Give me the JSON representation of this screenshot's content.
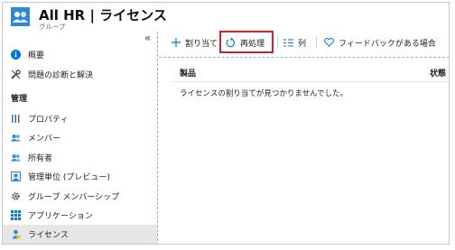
{
  "header": {
    "title": "All HR | ライセンス",
    "subtitle": "グループ"
  },
  "sidebar": {
    "collapse_glyph": "«",
    "items": [
      {
        "label": "概要",
        "icon": "info-icon"
      },
      {
        "label": "問題の診断と解決",
        "icon": "wrench-icon"
      }
    ],
    "section_label": "管理",
    "manage_items": [
      {
        "label": "プロパティ",
        "icon": "properties-icon"
      },
      {
        "label": "メンバー",
        "icon": "members-icon"
      },
      {
        "label": "所有者",
        "icon": "owners-icon"
      },
      {
        "label": "管理単位 (プレビュー)",
        "icon": "admin-unit-icon"
      },
      {
        "label": "グループ メンバーシップ",
        "icon": "gear-icon"
      },
      {
        "label": "アプリケーション",
        "icon": "apps-grid-icon"
      },
      {
        "label": "ライセンス",
        "icon": "license-icon",
        "selected": true
      }
    ]
  },
  "toolbar": {
    "assign_label": "割り当て",
    "reprocess_label": "再処理",
    "columns_label": "列",
    "feedback_label": "フィードバックがある場合"
  },
  "table": {
    "columns": [
      "製品",
      "状態"
    ],
    "empty_message": "ライセンスの割り当てが見つかりませんでした。"
  },
  "colors": {
    "accent": "#0078d4",
    "highlight": "#d8202a",
    "selected_bg": "#e6e6e6"
  }
}
